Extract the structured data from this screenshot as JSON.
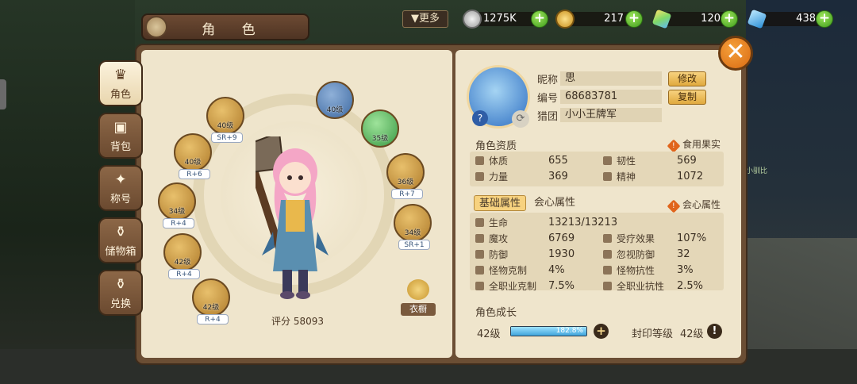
{
  "header": {
    "title": "角 色",
    "more": "▼更多",
    "close": "✕"
  },
  "currencies": [
    {
      "icon": "silver-coin-icon",
      "value": "1275K",
      "color": "#c9c9c9"
    },
    {
      "icon": "gold-coin-icon",
      "value": "217",
      "color": "#e7b53b"
    },
    {
      "icon": "rainbow-crystal-icon",
      "value": "120",
      "color": "#8bd36a"
    },
    {
      "icon": "blue-diamond-icon",
      "value": "438",
      "color": "#4fb6f0"
    }
  ],
  "sidebar": [
    {
      "label": "角色",
      "icon": "armor-icon",
      "glyph": "♛",
      "active": true
    },
    {
      "label": "背包",
      "icon": "backpack-icon",
      "glyph": "▣",
      "active": false
    },
    {
      "label": "称号",
      "icon": "title-icon",
      "glyph": "✦",
      "active": false
    },
    {
      "label": "储物箱",
      "icon": "storage-icon",
      "glyph": "⚱",
      "active": false
    },
    {
      "label": "兑换",
      "icon": "exchange-icon",
      "glyph": "⚱",
      "active": false
    }
  ],
  "equipment": [
    {
      "level": "40级",
      "badge": "SR+9",
      "icon": "weapon-icon",
      "tone": "gold"
    },
    {
      "level": "40级",
      "badge": "R+6",
      "icon": "armor-icon",
      "tone": "gold"
    },
    {
      "level": "34级",
      "badge": "R+4",
      "icon": "helmet-icon",
      "tone": "gold"
    },
    {
      "level": "42级",
      "badge": "R+4",
      "icon": "belt-icon",
      "tone": "gold"
    },
    {
      "level": "42级",
      "badge": "R+4",
      "icon": "boots-icon",
      "tone": "gold"
    },
    {
      "level": "40级",
      "badge": "",
      "icon": "orb-icon",
      "tone": "blue"
    },
    {
      "level": "35级",
      "badge": "",
      "icon": "bowl-icon",
      "tone": "green"
    },
    {
      "level": "36级",
      "badge": "R+7",
      "icon": "shoulder-icon",
      "tone": "gold"
    },
    {
      "level": "34级",
      "badge": "SR+1",
      "icon": "gloves-icon",
      "tone": "gold"
    }
  ],
  "wardrobe": {
    "label": "衣橱"
  },
  "score": {
    "label": "评分",
    "value": "58093"
  },
  "profile": {
    "nickname_label": "昵称",
    "nickname": "思",
    "edit": "修改",
    "id_label": "编号",
    "id": "68683781",
    "copy": "复制",
    "guild_label": "猎团",
    "guild": "小小王牌军"
  },
  "aptitude": {
    "title": "角色资质",
    "link": "食用果实",
    "stats": [
      {
        "label": "体质",
        "value": "655"
      },
      {
        "label": "韧性",
        "value": "569"
      },
      {
        "label": "力量",
        "value": "369"
      },
      {
        "label": "精神",
        "value": "1072"
      }
    ]
  },
  "attributes": {
    "tab_basic": "基础属性",
    "tab_crit": "会心属性",
    "link": "会心属性",
    "hp_label": "生命",
    "hp": "13213/13213",
    "stats": [
      {
        "label": "魔攻",
        "value": "6769"
      },
      {
        "label": "受疗效果",
        "value": "107%"
      },
      {
        "label": "防御",
        "value": "1930"
      },
      {
        "label": "忽视防御",
        "value": "32"
      },
      {
        "label": "怪物克制",
        "value": "4%"
      },
      {
        "label": "怪物抗性",
        "value": "3%"
      },
      {
        "label": "全职业克制",
        "value": "7.5%"
      },
      {
        "label": "全职业抗性",
        "value": "2.5%"
      }
    ]
  },
  "growth": {
    "title": "角色成长",
    "level": "42级",
    "progress_text": "182.8%",
    "progress": 1.0,
    "seal_label": "封印等级",
    "seal_level": "42级"
  },
  "background": {
    "ghost_label": "小驯比"
  }
}
